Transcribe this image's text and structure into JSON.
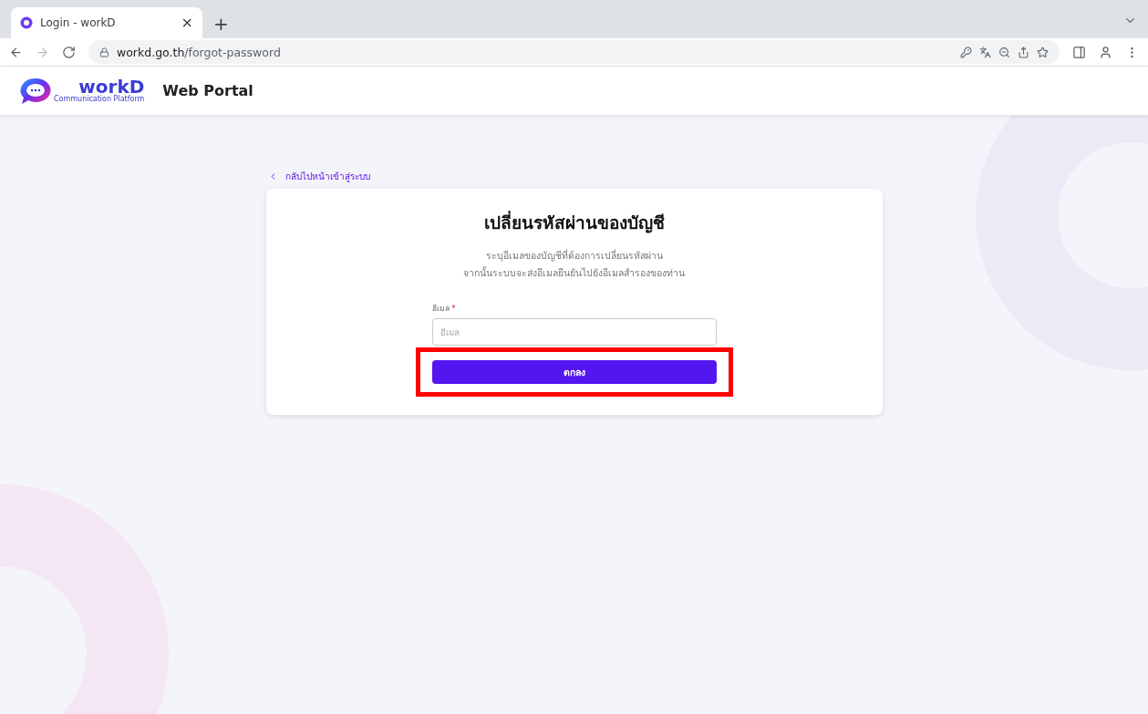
{
  "browser": {
    "tab": {
      "title": "Login - workD",
      "close": "×",
      "new_tab": "+"
    },
    "url": {
      "host": "workd.go.th",
      "path": "/forgot-password"
    }
  },
  "header": {
    "logo": {
      "name": "workD",
      "tagline": "Communication Platform"
    },
    "title": "Web Portal"
  },
  "back_link": "กลับไปหน้าเข้าสู่ระบบ",
  "card": {
    "title": "เปลี่ยนรหัสผ่านของบัญชี",
    "description": [
      "ระบุอีเมลของบัญชีที่ต้องการเปลี่ยนรหัสผ่าน",
      "จากนั้นระบบจะส่งอีเมลยืนยันไปยังอีเมลสำรองของท่าน"
    ],
    "field": {
      "label": "อีเมล",
      "required_mark": "*",
      "placeholder": "อีเมล"
    },
    "submit": {
      "label": "ตกลง",
      "highlighted": true
    }
  }
}
